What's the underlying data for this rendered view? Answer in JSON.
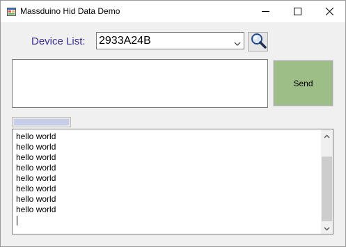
{
  "window": {
    "title": "Massduino Hid Data Demo"
  },
  "device": {
    "label": "Device List:",
    "selected": "2933A24B"
  },
  "input": {
    "value": ""
  },
  "send": {
    "label": "Send",
    "color": "#9ebe88"
  },
  "progress": {
    "value_percent": 100
  },
  "output": {
    "lines": [
      "hello world",
      "hello world",
      "hello world",
      "hello world",
      "hello world",
      "hello world",
      "hello world",
      "hello world"
    ]
  },
  "icons": {
    "app": "app-icon",
    "search": "magnifier-icon",
    "minimize": "minimize-icon",
    "maximize": "maximize-icon",
    "close": "close-icon"
  },
  "colors": {
    "label_text": "#3a2f8a",
    "window_bg": "#f0f0f0"
  }
}
